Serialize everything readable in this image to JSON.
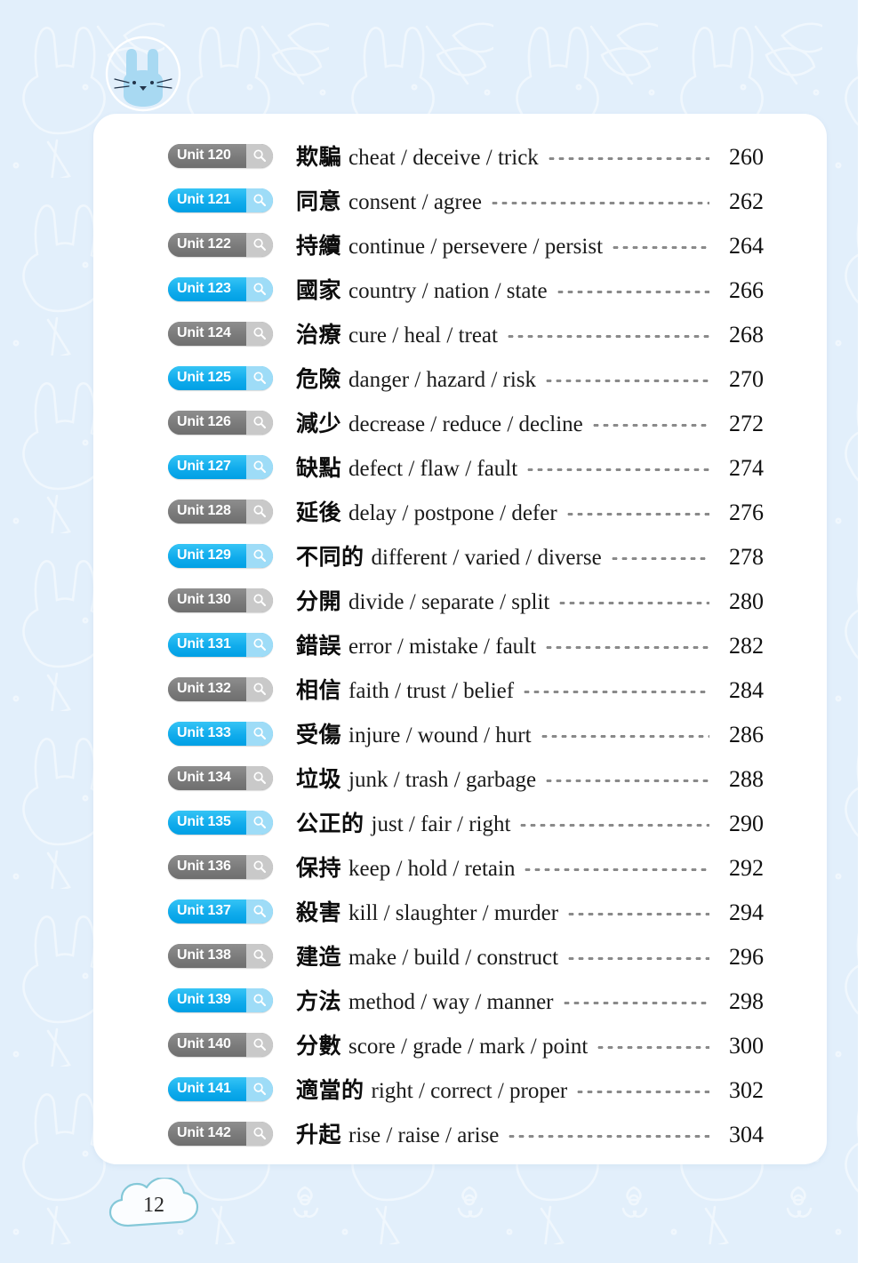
{
  "document": {
    "page_number": "12",
    "mascot_icon": "rabbit-face-icon",
    "badge_icon": "magnifier-icon",
    "colors": {
      "background": "#e2effb",
      "card": "#ffffff",
      "badge_blue": "#1fb6f0",
      "badge_blue_light": "#9edcf7",
      "badge_gray": "#828282",
      "badge_gray_light": "#c9c9c9",
      "leader_dot": "#8a8a8a",
      "text": "#111111"
    }
  },
  "toc": {
    "entries": [
      {
        "unit": "Unit 120",
        "style": "gray",
        "cn": "欺騙",
        "en": "cheat / deceive / trick",
        "page": "260"
      },
      {
        "unit": "Unit 121",
        "style": "blue",
        "cn": "同意",
        "en": "consent / agree",
        "page": "262"
      },
      {
        "unit": "Unit 122",
        "style": "gray",
        "cn": "持續",
        "en": "continue / persevere / persist",
        "page": "264"
      },
      {
        "unit": "Unit 123",
        "style": "blue",
        "cn": "國家",
        "en": "country / nation / state",
        "page": "266"
      },
      {
        "unit": "Unit 124",
        "style": "gray",
        "cn": "治療",
        "en": "cure / heal / treat",
        "page": "268"
      },
      {
        "unit": "Unit 125",
        "style": "blue",
        "cn": "危險",
        "en": "danger / hazard / risk",
        "page": "270"
      },
      {
        "unit": "Unit 126",
        "style": "gray",
        "cn": "減少",
        "en": "decrease / reduce / decline",
        "page": "272"
      },
      {
        "unit": "Unit 127",
        "style": "blue",
        "cn": "缺點",
        "en": "defect / flaw / fault",
        "page": "274"
      },
      {
        "unit": "Unit 128",
        "style": "gray",
        "cn": "延後",
        "en": "delay / postpone / defer",
        "page": "276"
      },
      {
        "unit": "Unit 129",
        "style": "blue",
        "cn": "不同的",
        "en": "different / varied / diverse",
        "page": "278"
      },
      {
        "unit": "Unit 130",
        "style": "gray",
        "cn": "分開",
        "en": "divide / separate / split",
        "page": "280"
      },
      {
        "unit": "Unit 131",
        "style": "blue",
        "cn": "錯誤",
        "en": "error / mistake / fault",
        "page": "282"
      },
      {
        "unit": "Unit 132",
        "style": "gray",
        "cn": "相信",
        "en": "faith / trust / belief",
        "page": "284"
      },
      {
        "unit": "Unit 133",
        "style": "blue",
        "cn": "受傷",
        "en": "injure / wound / hurt",
        "page": "286"
      },
      {
        "unit": "Unit 134",
        "style": "gray",
        "cn": "垃圾",
        "en": "junk / trash / garbage",
        "page": "288"
      },
      {
        "unit": "Unit 135",
        "style": "blue",
        "cn": "公正的",
        "en": "just / fair / right",
        "page": "290"
      },
      {
        "unit": "Unit 136",
        "style": "gray",
        "cn": "保持",
        "en": "keep / hold / retain",
        "page": "292"
      },
      {
        "unit": "Unit 137",
        "style": "blue",
        "cn": "殺害",
        "en": "kill / slaughter / murder",
        "page": "294"
      },
      {
        "unit": "Unit 138",
        "style": "gray",
        "cn": "建造",
        "en": "make / build / construct",
        "page": "296"
      },
      {
        "unit": "Unit 139",
        "style": "blue",
        "cn": "方法",
        "en": "method / way / manner",
        "page": "298"
      },
      {
        "unit": "Unit 140",
        "style": "gray",
        "cn": "分數",
        "en": "score / grade / mark / point",
        "page": "300"
      },
      {
        "unit": "Unit 141",
        "style": "blue",
        "cn": "適當的",
        "en": "right / correct / proper",
        "page": "302"
      },
      {
        "unit": "Unit 142",
        "style": "gray",
        "cn": "升起",
        "en": "rise / raise / arise",
        "page": "304"
      }
    ]
  }
}
